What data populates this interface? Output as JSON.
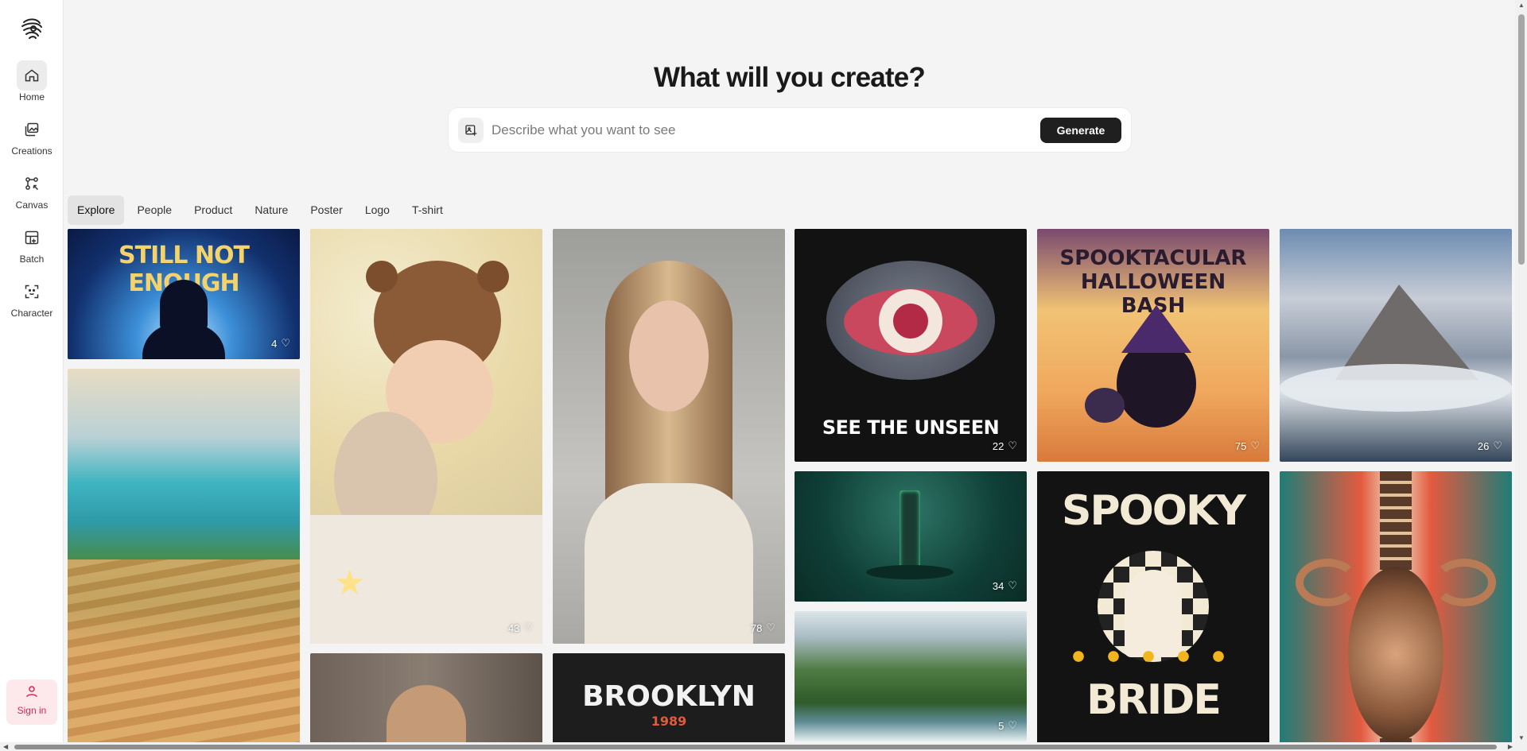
{
  "app": {
    "headline": "What will you create?"
  },
  "sidebar": {
    "items": [
      {
        "label": "Home",
        "icon": "home-icon"
      },
      {
        "label": "Creations",
        "icon": "images-icon"
      },
      {
        "label": "Canvas",
        "icon": "canvas-icon"
      },
      {
        "label": "Batch",
        "icon": "batch-icon"
      },
      {
        "label": "Character",
        "icon": "character-icon"
      }
    ],
    "signin_label": "Sign in"
  },
  "prompt": {
    "placeholder": "Describe what you want to see",
    "value": "",
    "generate_label": "Generate"
  },
  "tabs": [
    "Explore",
    "People",
    "Product",
    "Nature",
    "Poster",
    "Logo",
    "T-shirt"
  ],
  "gallery": {
    "cards": [
      {
        "likes": "4",
        "text": "STILL NOT ENOUGH",
        "subject": "silhouette poster"
      },
      {
        "likes": "",
        "text": "",
        "subject": "coastal landscape with sand dunes"
      },
      {
        "likes": "43",
        "text": "",
        "subject": "baby sleeping with teddy bear"
      },
      {
        "likes": "",
        "text": "",
        "subject": "turban portrait"
      },
      {
        "likes": "78",
        "text": "",
        "subject": "woman portrait"
      },
      {
        "likes": "",
        "text": "BROOKLYN",
        "subtext": "1989",
        "subject": "brooklyn t-shirt"
      },
      {
        "likes": "22",
        "text": "SEE THE UNSEEN",
        "subject": "eye illustration"
      },
      {
        "likes": "34",
        "text": "",
        "subject": "product bottle"
      },
      {
        "likes": "5",
        "text": "",
        "subject": "coastal cliffs"
      },
      {
        "likes": "75",
        "text": "SPOOKTACULAR HALLOWEEN BASH",
        "subject": "witch cat poster"
      },
      {
        "likes": "",
        "text": "SPOOKY",
        "subtext": "BRIDE",
        "subject": "ghost t-shirt"
      },
      {
        "likes": "26",
        "text": "",
        "subject": "mountain above clouds"
      },
      {
        "likes": "",
        "text": "",
        "subject": "ornamental scorpion"
      }
    ]
  },
  "colors": {
    "accent_signin": "#d7264f",
    "generate_bg": "#1f1f1f"
  }
}
